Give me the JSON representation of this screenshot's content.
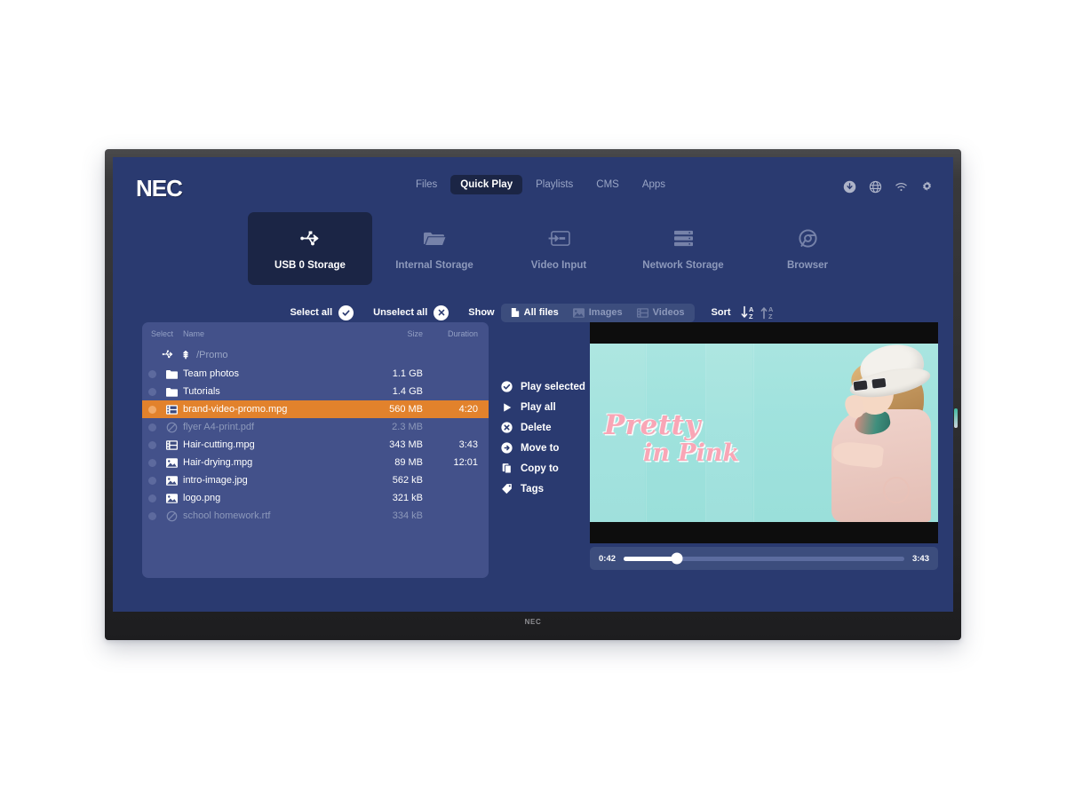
{
  "device": {
    "brand_logo": "NEC",
    "bezel_logo": "NEC"
  },
  "header": {
    "logo": "NEC",
    "nav": [
      {
        "label": "Files",
        "active": false
      },
      {
        "label": "Quick Play",
        "active": true
      },
      {
        "label": "Playlists",
        "active": false
      },
      {
        "label": "CMS",
        "active": false
      },
      {
        "label": "Apps",
        "active": false
      }
    ],
    "status_icons": [
      {
        "name": "download-icon"
      },
      {
        "name": "globe-icon"
      },
      {
        "name": "wifi-icon"
      },
      {
        "name": "gear-icon"
      }
    ]
  },
  "sources": [
    {
      "label": "USB 0 Storage",
      "icon": "usb-icon",
      "active": true
    },
    {
      "label": "Internal Storage",
      "icon": "folder-icon",
      "active": false
    },
    {
      "label": "Video Input",
      "icon": "video-input-icon",
      "active": false
    },
    {
      "label": "Network Storage",
      "icon": "server-icon",
      "active": false
    },
    {
      "label": "Browser",
      "icon": "chrome-icon",
      "active": false
    }
  ],
  "toolbar": {
    "select_all_label": "Select all",
    "unselect_all_label": "Unselect all",
    "show_label": "Show",
    "filters": [
      {
        "label": "All files",
        "icon": "document-icon",
        "active": true
      },
      {
        "label": "Images",
        "icon": "image-icon",
        "active": false
      },
      {
        "label": "Videos",
        "icon": "film-icon",
        "active": false
      }
    ],
    "sort_label": "Sort",
    "sort_desc_icon": "sort-descending-icon",
    "sort_asc_icon": "sort-ascending-icon"
  },
  "file_list": {
    "columns": {
      "select": "Select",
      "name": "Name",
      "size": "Size",
      "duration": "Duration"
    },
    "breadcrumb": {
      "device_icon": "usb-icon",
      "up_icon": "level-up-icon",
      "path": "/Promo"
    },
    "rows": [
      {
        "name": "Team photos",
        "size": "1.1 GB",
        "duration": "",
        "icon": "folder-icon",
        "state": "normal",
        "selected": false
      },
      {
        "name": "Tutorials",
        "size": "1.4 GB",
        "duration": "",
        "icon": "folder-icon",
        "state": "normal",
        "selected": false
      },
      {
        "name": "brand-video-promo.mpg",
        "size": "560 MB",
        "duration": "4:20",
        "icon": "film-icon",
        "state": "normal",
        "selected": true
      },
      {
        "name": "flyer A4-print.pdf",
        "size": "2.3 MB",
        "duration": "",
        "icon": "blocked-icon",
        "state": "disabled",
        "selected": false
      },
      {
        "name": "Hair-cutting.mpg",
        "size": "343 MB",
        "duration": "3:43",
        "icon": "film-icon",
        "state": "normal",
        "selected": false
      },
      {
        "name": "Hair-drying.mpg",
        "size": "89 MB",
        "duration": "12:01",
        "icon": "image-icon",
        "state": "normal",
        "selected": false
      },
      {
        "name": "intro-image.jpg",
        "size": "562 kB",
        "duration": "",
        "icon": "image-icon",
        "state": "normal",
        "selected": false
      },
      {
        "name": "logo.png",
        "size": "321 kB",
        "duration": "",
        "icon": "image-icon",
        "state": "normal",
        "selected": false
      },
      {
        "name": "school homework.rtf",
        "size": "334 kB",
        "duration": "",
        "icon": "blocked-icon",
        "state": "disabled",
        "selected": false
      }
    ]
  },
  "actions": [
    {
      "label": "Play selected",
      "icon": "check-circle-icon"
    },
    {
      "label": "Play all",
      "icon": "play-icon"
    },
    {
      "label": "Delete",
      "icon": "close-circle-icon"
    },
    {
      "label": "Move to",
      "icon": "move-circle-icon"
    },
    {
      "label": "Copy to",
      "icon": "copy-icon"
    },
    {
      "label": "Tags",
      "icon": "tag-icon"
    }
  ],
  "preview": {
    "video_title_line1": "Pretty",
    "video_title_line2": "in Pink",
    "current_time": "0:42",
    "total_time": "3:43",
    "progress_percent": 19
  },
  "colors": {
    "screen_bg": "#2a3a70",
    "panel_bg": "#43518a",
    "accent_selected": "#e2822c",
    "nav_active_bg": "#1b2545",
    "muted_text": "#8d99bb"
  }
}
